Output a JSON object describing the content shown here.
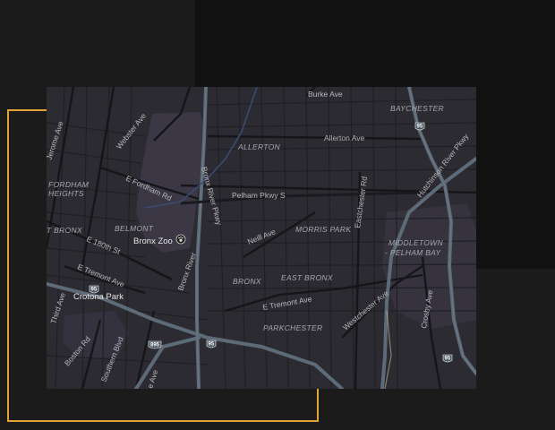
{
  "colors": {
    "accent_frame": "#e0a339",
    "map_background": "#2c2b31",
    "highway": "#5d6b78",
    "street": "#1e1e22",
    "park": "#3b3744",
    "page_background": "#1b1b1b"
  },
  "map": {
    "areas": {
      "baychester": "BAYCHESTER",
      "allerton": "ALLERTON",
      "fordham_heights_1": "FORDHAM",
      "fordham_heights_2": "HEIGHTS",
      "belmont": "BELMONT",
      "west_bronx": "T BRONX",
      "morris_park": "MORRIS PARK",
      "middletown_1": "MIDDLETOWN",
      "middletown_2": "- PELHAM BAY",
      "bronx": "BRONX",
      "east_bronx": "EAST BRONX",
      "parkchester": "PARKCHESTER"
    },
    "streets": {
      "burke_ave": "Burke Ave",
      "webster_ave": "Webster Ave",
      "jerome_ave": "Jerome Ave",
      "allerton_ave": "Allerton Ave",
      "hutchinson": "Hutchinson River Pkwy",
      "e_fordham_rd": "E Fordham Rd",
      "bronx_river_pkwy_north": "Bronx River Pkwy",
      "pelham_pkwy": "Pelham Pkwy S",
      "eastchester_rd": "Eastchester Rd",
      "neill_ave": "Neill Ave",
      "e_180th_st": "E 180th St",
      "bronx_river_south": "Bronx River",
      "e_tremont_west": "E Tremont Ave",
      "e_tremont_east": "E Tremont Ave",
      "westchester_ave": "Westchester Ave",
      "crosby_ave": "Crosby Ave",
      "third_ave": "Third Ave",
      "boston_rd": "Boston Rd",
      "southern_blvd": "Southern Blvd",
      "e_ave": "e Ave"
    },
    "pois": {
      "bronx_zoo": "Bronx Zoo",
      "crotona_park": "Crotona Park"
    },
    "shields": {
      "i95_north": "95",
      "i95_west": "95",
      "i95_mid": "95",
      "i95_east": "95",
      "i895": "895"
    },
    "icons": {
      "zoo": "paw-icon"
    }
  }
}
